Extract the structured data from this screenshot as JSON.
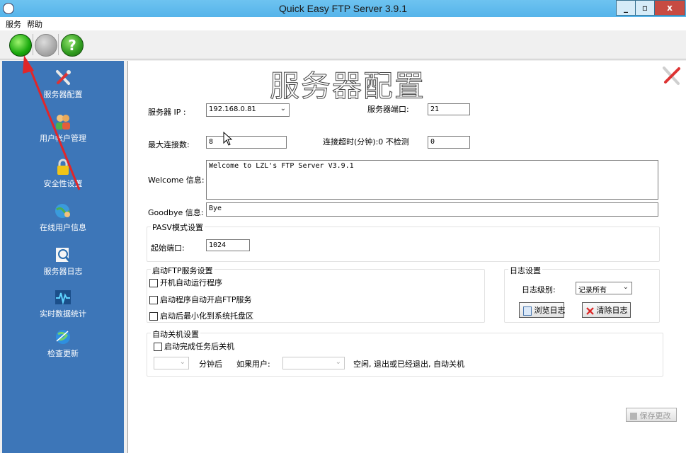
{
  "window": {
    "title": "Quick Easy FTP Server 3.9.1",
    "min_glyph": "_",
    "max_glyph": "▫",
    "close_glyph": "x"
  },
  "menu": [
    "服务",
    "帮助"
  ],
  "toolbar": {
    "help_glyph": "?"
  },
  "sidebar": {
    "items": [
      {
        "label": "服务器配置",
        "icon": "tools-icon"
      },
      {
        "label": "用户帐户管理",
        "icon": "users-icon"
      },
      {
        "label": "安全性设置",
        "icon": "lock-icon"
      },
      {
        "label": "在线用户信息",
        "icon": "globe-user-icon"
      },
      {
        "label": "服务器日志",
        "icon": "log-magnifier-icon"
      },
      {
        "label": "实时数据统计",
        "icon": "pulse-icon"
      },
      {
        "label": "检查更新",
        "icon": "update-globe-icon"
      }
    ]
  },
  "config": {
    "heading": "服务器配置",
    "server_ip_label": "服务器 IP :",
    "server_ip": "192.168.0.81",
    "server_port_label": "服务器端口:",
    "server_port": "21",
    "max_conn_label": "最大连接数:",
    "max_conn": "8",
    "timeout_label": "连接超时(分钟):0 不检测",
    "timeout": "0",
    "welcome_label": "Welcome 信息:",
    "welcome": "Welcome to LZL's FTP Server V3.9.1",
    "goodbye_label": "Goodbye 信息:",
    "goodbye": "Bye",
    "pasv_group": "PASV模式设置",
    "start_port_label": "起始端口:",
    "start_port": "1024",
    "startup_group": "启动FTP服务设置",
    "startup_options": [
      "开机自动运行程序",
      "启动程序自动开启FTP服务",
      "启动后最小化到系统托盘区"
    ],
    "log_group": "日志设置",
    "log_level_label": "日志级别:",
    "log_level": "记录所有",
    "browse_log": "浏览日志",
    "clear_log": "清除日志",
    "shutdown_group": "自动关机设置",
    "shutdown_option": "启动完成任务后关机",
    "minutes_after": "分钟后",
    "if_user": "如果用户:",
    "shutdown_tail": "空闲, 退出或已经退出, 自动关机",
    "save_button": "保存更改"
  },
  "colors": {
    "sidebar": "#3d76b8",
    "titlebar": "#56b4ea",
    "annotation_arrow": "#e0262a"
  }
}
